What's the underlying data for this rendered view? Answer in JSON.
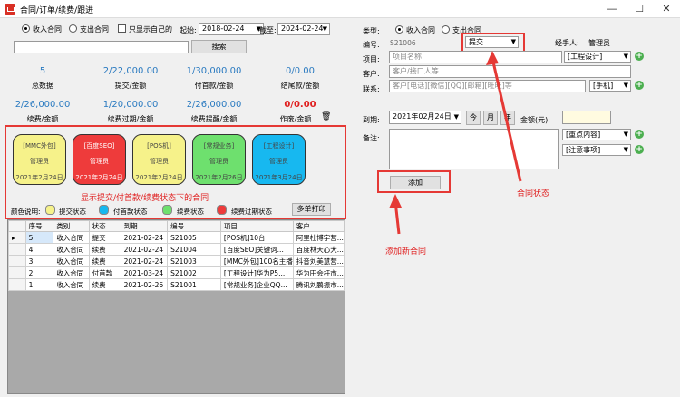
{
  "window": {
    "title": "合同/订单/续费/跟进",
    "min": "—",
    "max": "☐",
    "close": "✕"
  },
  "filter": {
    "radio_income": "收入合同",
    "radio_expense": "支出合同",
    "only_mine": "只显示自己的",
    "start_label": "起始:",
    "start_date": "2018-02-24",
    "end_label": "截至:",
    "end_date": "2024-02-24",
    "search_placeholder": "",
    "search_btn": "搜索"
  },
  "stats": [
    {
      "value": "5",
      "label": "总数据"
    },
    {
      "value": "2/22,000.00",
      "label": "提交/金额"
    },
    {
      "value": "1/30,000.00",
      "label": "付首款/金额"
    },
    {
      "value": "0/0.00",
      "label": "结尾款/金额"
    },
    {
      "value": "2/26,000.00",
      "label": "续费/金额"
    },
    {
      "value": "1/20,000.00",
      "label": "续费过期/金额"
    },
    {
      "value": "2/26,000.00",
      "label": "续费提醒/金额"
    },
    {
      "value": "0/0.00",
      "label": "作废/金额"
    }
  ],
  "cards": [
    {
      "title": "[MMC外包]",
      "person": "管理员",
      "date": "2021年2月24日",
      "color": "#f6f28a",
      "text": "#444"
    },
    {
      "title": "[百度SEO]",
      "person": "管理员",
      "date": "2021年2月24日",
      "color": "#ee3b3b",
      "text": "#fff"
    },
    {
      "title": "[POS机]",
      "person": "管理员",
      "date": "2021年2月24日",
      "color": "#f6f28a",
      "text": "#444"
    },
    {
      "title": "[常规业务]",
      "person": "管理员",
      "date": "2021年2月26日",
      "color": "#6ee06e",
      "text": "#444"
    },
    {
      "title": "[工程设计]",
      "person": "管理员",
      "date": "2021年3月24日",
      "color": "#17b8f0",
      "text": "#444"
    }
  ],
  "card_note": "显示提交/付首款/续费状态下的合同",
  "legend": {
    "title": "颜色说明:",
    "items": [
      {
        "label": "提交状态",
        "color": "#f6f28a"
      },
      {
        "label": "付首款状态",
        "color": "#17b8f0"
      },
      {
        "label": "续费状态",
        "color": "#6ee06e"
      },
      {
        "label": "续费过期状态",
        "color": "#ee3b3b"
      }
    ],
    "print_btn": "多单打印"
  },
  "table": {
    "columns": [
      "",
      "序号",
      "类别",
      "状态",
      "到期",
      "编号",
      "项目",
      "客户"
    ],
    "rows": [
      [
        "▸",
        "5",
        "收入合同",
        "提交",
        "2021-02-24",
        "S21005",
        "[POS机]10台",
        "阿里杜博宇营..."
      ],
      [
        "",
        "4",
        "收入合同",
        "续费",
        "2021-02-24",
        "S21004",
        "[百度SEO]关键词...",
        "百度林天心大..."
      ],
      [
        "",
        "3",
        "收入合同",
        "续费",
        "2021-02-24",
        "S21003",
        "[MMC外包]100名主播",
        "抖音刘美慧营..."
      ],
      [
        "",
        "2",
        "收入合同",
        "付首款",
        "2021-03-24",
        "S21002",
        "[工程设计]华为P5...",
        "华为田会杆市..."
      ],
      [
        "",
        "1",
        "收入合同",
        "续费",
        "2021-02-26",
        "S21001",
        "[常规业务]企业QQ...",
        "腾讯刘鹏振市..."
      ]
    ]
  },
  "form": {
    "type_label": "类型:",
    "type_income": "收入合同",
    "type_expense": "支出合同",
    "code_label": "编号:",
    "code_value": "S21006",
    "status_value": "提交",
    "manager_label": "经手人:",
    "manager_value": "管理员",
    "project_label": "项目:",
    "project_placeholder": "项目名称",
    "project_category": "[工程设计]",
    "client_label": "客户:",
    "client_placeholder": "客户/接口人等",
    "contact_label": "联系:",
    "contact_placeholder": "客户[电话][微信][QQ][邮箱][旺旺]等",
    "contact_type": "[手机]",
    "due_label": "到期:",
    "due_value": "2021年02月24日",
    "btn_month": "今",
    "btn_mon": "月",
    "btn_year": "年",
    "amount_label": "金额(元):",
    "amount_value": "",
    "note_label": "备注:",
    "note_tag1": "[重点内容]",
    "note_tag2": "[注意事项]",
    "add_btn": "添加"
  },
  "annotations": {
    "status": "合同状态",
    "add": "添加新合同"
  }
}
